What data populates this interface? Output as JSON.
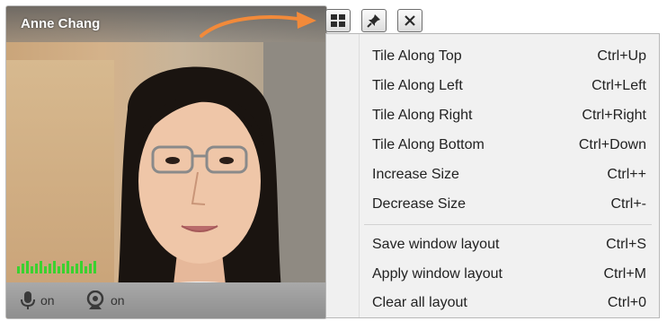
{
  "window": {
    "caller_name": "Anne Chang"
  },
  "toolbar": {
    "buttons": [
      {
        "icon": "tile-layout-icon"
      },
      {
        "icon": "pin-icon"
      },
      {
        "icon": "close-icon"
      }
    ]
  },
  "controls": {
    "mic_label": "on",
    "camera_label": "on"
  },
  "audio_level": 0.9,
  "menu": {
    "items": [
      {
        "label": "Tile Along Top",
        "shortcut": "Ctrl+Up"
      },
      {
        "label": "Tile Along Left",
        "shortcut": "Ctrl+Left"
      },
      {
        "label": "Tile Along Right",
        "shortcut": "Ctrl+Right"
      },
      {
        "label": "Tile Along Bottom",
        "shortcut": "Ctrl+Down"
      },
      {
        "label": "Increase Size",
        "shortcut": "Ctrl++"
      },
      {
        "label": "Decrease Size",
        "shortcut": "Ctrl+-"
      },
      {
        "label": "Save window layout",
        "shortcut": "Ctrl+S"
      },
      {
        "label": "Apply window layout",
        "shortcut": "Ctrl+M"
      },
      {
        "label": "Clear all layout",
        "shortcut": "Ctrl+0"
      }
    ]
  },
  "colors": {
    "arrow": "#f28a3a",
    "audio_level": "#3bd130"
  }
}
